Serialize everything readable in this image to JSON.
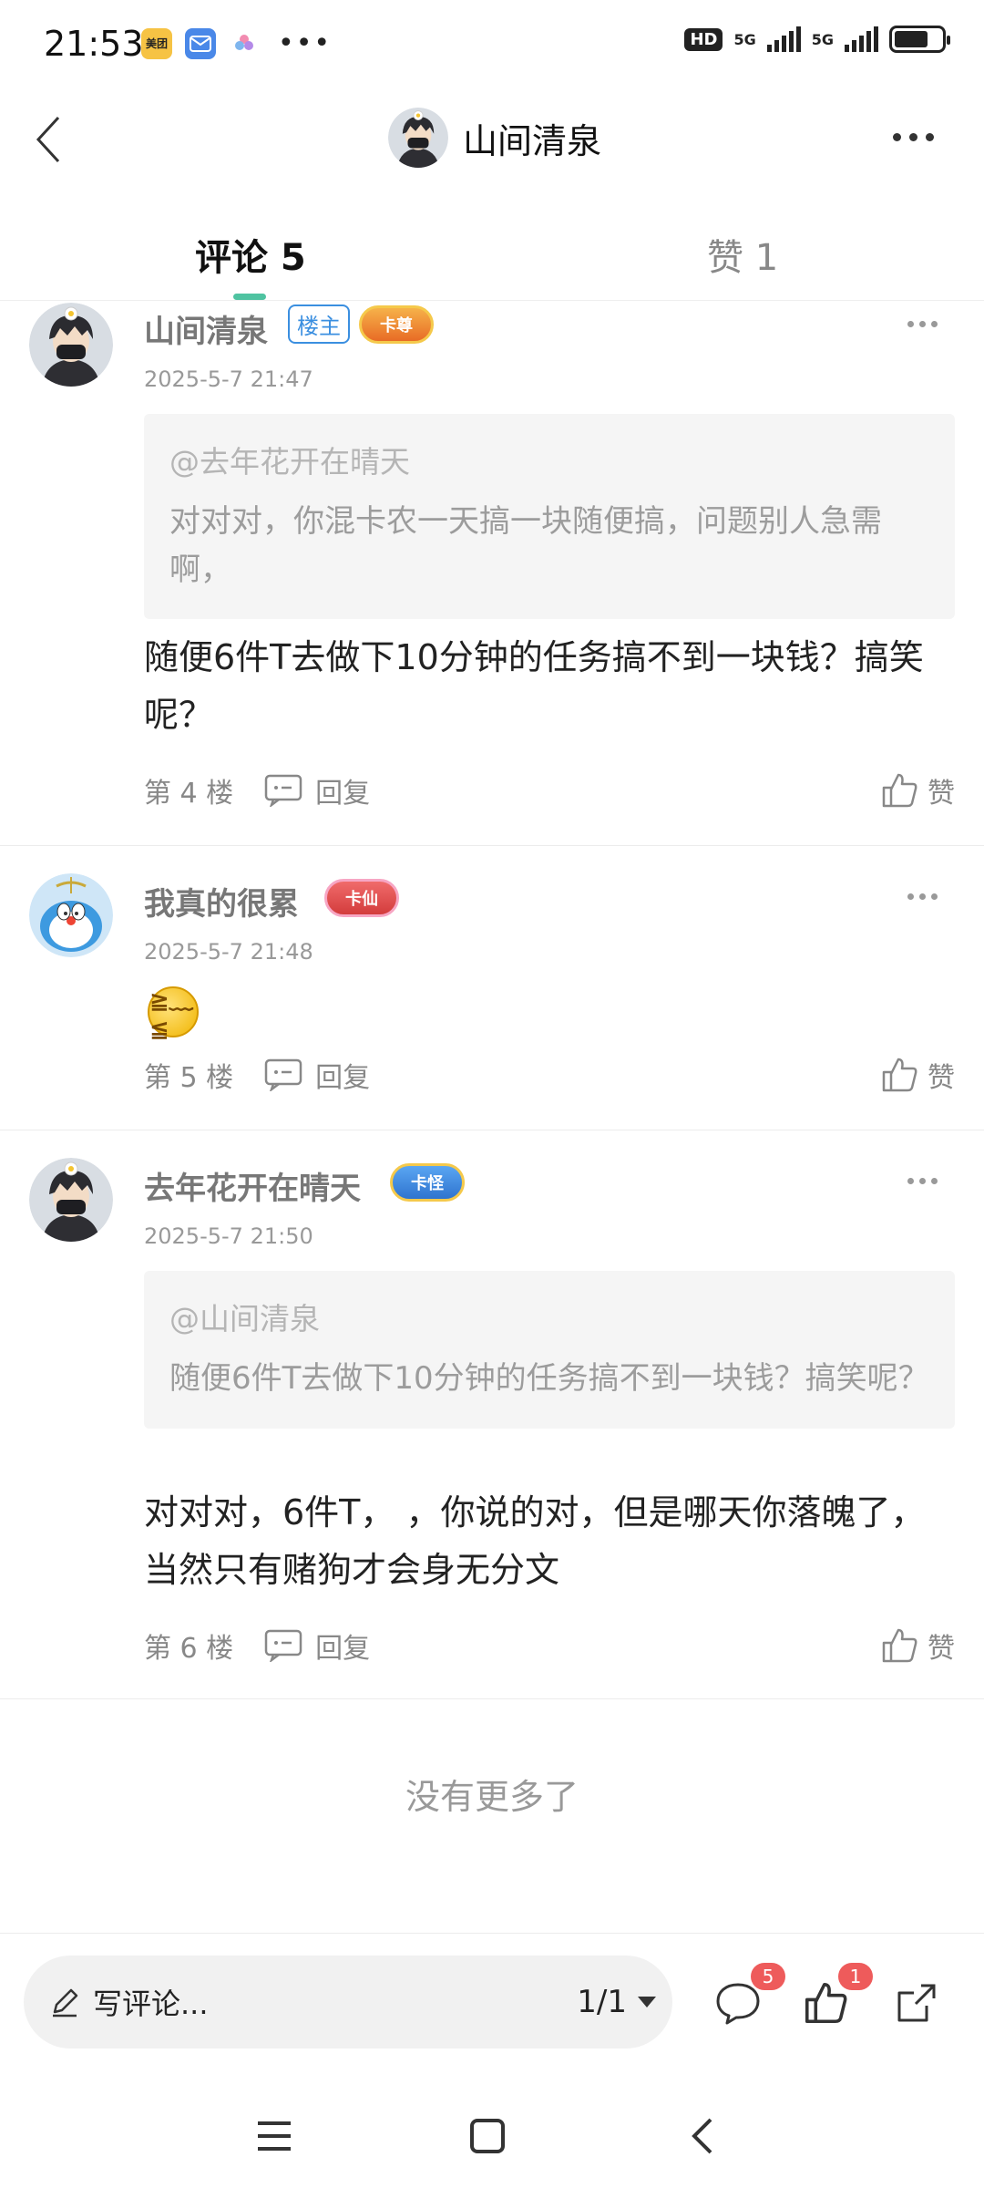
{
  "status_bar": {
    "time": "21:53",
    "apps": [
      "美团",
      "mail",
      "flower"
    ],
    "network": "5G",
    "network2": "5G",
    "hd": "HD"
  },
  "header": {
    "title": "山间清泉"
  },
  "tabs": {
    "comments_label": "评论 5",
    "likes_label": "赞 1"
  },
  "comments": [
    {
      "author": "山间清泉",
      "owner_badge": "楼主",
      "rank_badge": "卡尊",
      "time": "2025-5-7 21:47",
      "quote_author": "@去年花开在晴天",
      "quote_text": "对对对，你混卡农一天搞一块随便搞，问题别人急需啊，",
      "body": "随便6件T去做下10分钟的任务搞不到一块钱？搞笑呢？",
      "floor": "第 4 楼",
      "reply": "回复",
      "like": "赞"
    },
    {
      "author": "我真的很累",
      "rank_badge": "卡仙",
      "time": "2025-5-7 21:48",
      "floor": "第 5 楼",
      "reply": "回复",
      "like": "赞"
    },
    {
      "author": "去年花开在晴天",
      "rank_badge": "卡怪",
      "time": "2025-5-7 21:50",
      "quote_author": "@山间清泉",
      "quote_text": "随便6件T去做下10分钟的任务搞不到一块钱？搞笑呢？",
      "body": "对对对，6件T，  ，你说的对，但是哪天你落魄了，当然只有赌狗才会身无分文",
      "floor": "第 6 楼",
      "reply": "回复",
      "like": "赞"
    }
  ],
  "no_more": "没有更多了",
  "bottom_bar": {
    "write_placeholder": "写评论...",
    "page_indicator": "1/1",
    "comment_count": "5",
    "like_count": "1"
  },
  "colors": {
    "accent_green": "#4fc3a1",
    "badge_red": "#ee5b5b",
    "owner_blue": "#3b8fe0"
  }
}
